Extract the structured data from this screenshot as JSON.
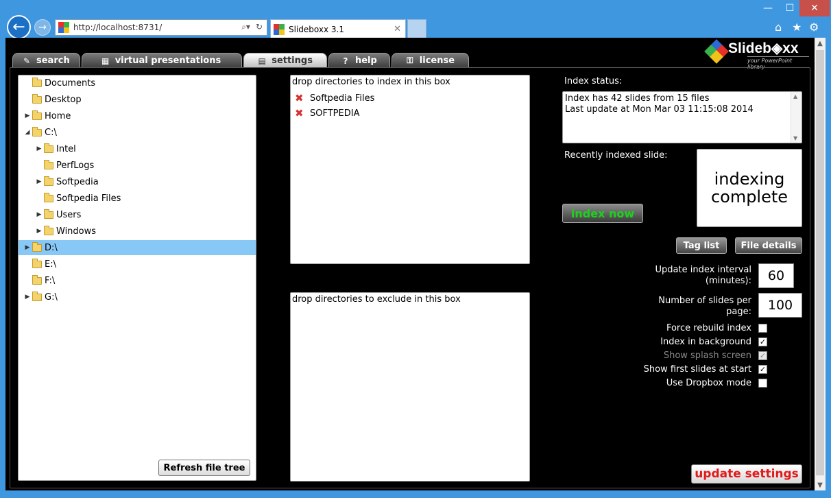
{
  "browser": {
    "address": "http://localhost:8731/",
    "tab_title": "Slideboxx 3.1",
    "back_glyph": "←",
    "forward_glyph": "→",
    "search_glyph": "⌕▾",
    "refresh_glyph": "↻",
    "close_glyph": "✕",
    "minimize_glyph": "—",
    "maximize_glyph": "☐",
    "home_glyph": "⌂",
    "star_glyph": "★",
    "gear_glyph": "⚙",
    "icons": [
      "back-arrow-icon",
      "forward-arrow-icon",
      "search-icon",
      "refresh-icon",
      "home-icon",
      "star-icon",
      "gear-icon"
    ]
  },
  "app": {
    "logo_name": "Slideb◈xx",
    "logo_tagline": "your PowerPoint library",
    "tabs": [
      {
        "label": "search",
        "icon": "✎"
      },
      {
        "label": "virtual presentations",
        "icon": "▦"
      },
      {
        "label": "settings",
        "icon": "▤"
      },
      {
        "label": "help",
        "icon": "?"
      },
      {
        "label": "license",
        "icon": "⚿"
      }
    ],
    "active_tab": "settings"
  },
  "tree": {
    "items": [
      {
        "label": "Documents",
        "arrow": ""
      },
      {
        "label": "Desktop",
        "arrow": ""
      },
      {
        "label": "Home",
        "arrow": "▶"
      },
      {
        "label": "C:\\",
        "arrow": "◢"
      },
      {
        "label": "Intel",
        "arrow": "▶"
      },
      {
        "label": "PerfLogs",
        "arrow": ""
      },
      {
        "label": "Softpedia",
        "arrow": "▶"
      },
      {
        "label": "Softpedia Files",
        "arrow": ""
      },
      {
        "label": "Users",
        "arrow": "▶"
      },
      {
        "label": "Windows",
        "arrow": "▶"
      },
      {
        "label": "D:\\",
        "arrow": "▶"
      },
      {
        "label": "E:\\",
        "arrow": ""
      },
      {
        "label": "F:\\",
        "arrow": ""
      },
      {
        "label": "G:\\",
        "arrow": "▶"
      }
    ],
    "selected": "D:\\",
    "refresh_label": "Refresh file tree"
  },
  "include_box": {
    "header": "drop directories to index in this box",
    "items": [
      "Softpedia Files",
      "SOFTPEDIA"
    ],
    "remove_glyph": "✖"
  },
  "exclude_box": {
    "header": "drop directories to exclude in this box"
  },
  "status": {
    "label": "Index status:",
    "lines": [
      "Index has 42 slides from 15 files",
      "Last update at Mon Mar 03 11:15:08 2014"
    ],
    "scroll_up": "▲",
    "scroll_down": "▼"
  },
  "recent": {
    "label": "Recently indexed slide:",
    "preview_line1": "indexing",
    "preview_line2": "complete"
  },
  "buttons": {
    "index_now": "index now",
    "tag_list": "Tag list",
    "file_details": "File details",
    "update_settings": "update settings"
  },
  "settings": {
    "update_interval_label_1": "Update index interval",
    "update_interval_label_2": "(minutes):",
    "update_interval_value": "60",
    "slides_per_page_label_1": "Number of slides per",
    "slides_per_page_label_2": "page:",
    "slides_per_page_value": "100",
    "checkboxes": [
      {
        "label": "Force rebuild index",
        "mark": ""
      },
      {
        "label": "Index in background",
        "mark": "✓"
      },
      {
        "label": "Show splash screen",
        "mark": "✓"
      },
      {
        "label": "Show first slides at start",
        "mark": "✓"
      },
      {
        "label": "Use Dropbox mode",
        "mark": ""
      }
    ]
  },
  "colors": {
    "titlebar": "#3f97e0",
    "page_background": "#000000",
    "index_now_text": "#1bd31b",
    "update_settings_text": "#e21a1a",
    "tree_selected": "#88c8f7"
  }
}
